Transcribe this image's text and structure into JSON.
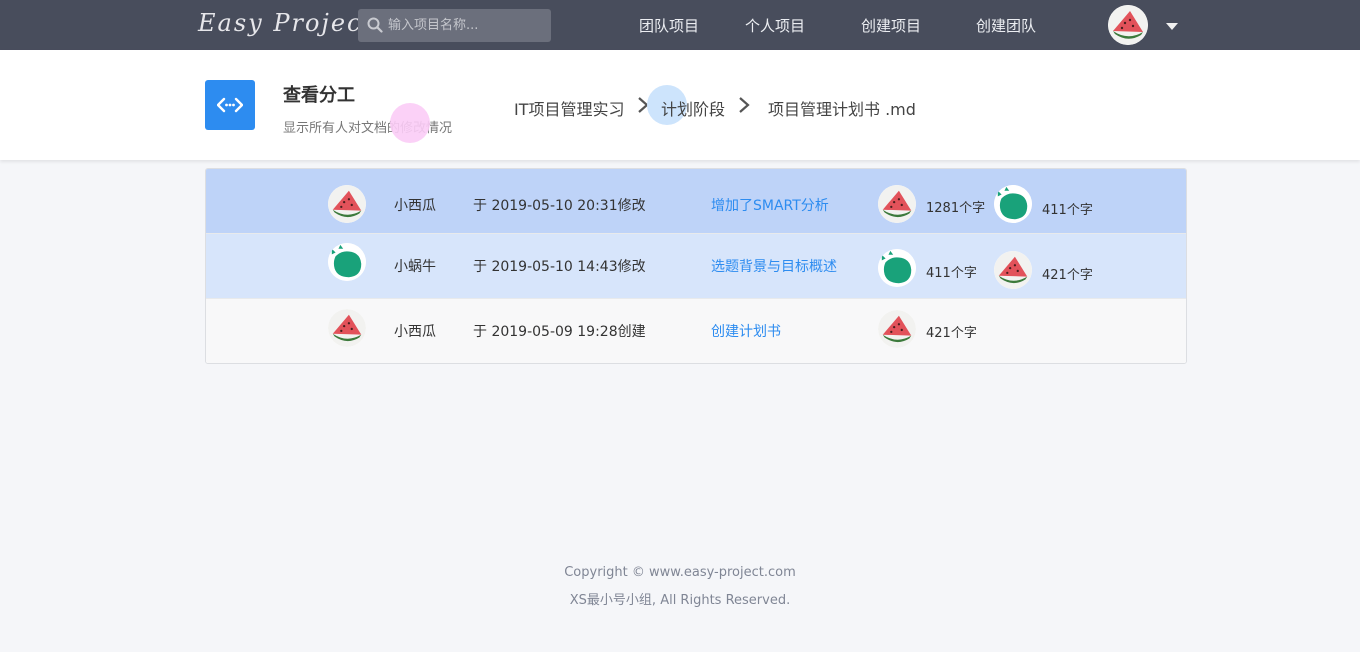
{
  "app": {
    "logo_text": "Easy Project"
  },
  "search": {
    "placeholder": "输入项目名称..."
  },
  "nav": {
    "items": [
      "团队项目",
      "个人项目",
      "创建项目",
      "创建团队"
    ]
  },
  "header": {
    "title": "查看分工",
    "subtitle": "显示所有人对文档的修改情况",
    "breadcrumb": [
      "IT项目管理实习",
      "计划阶段",
      "项目管理计划书 .md"
    ]
  },
  "edits": [
    {
      "user": "小西瓜",
      "avatar": "watermelon-avatar",
      "time": "于 2019-05-10 20:31修改",
      "message": "增加了SMART分析",
      "contributions": [
        {
          "avatar": "watermelon-avatar",
          "count": "1281个字"
        },
        {
          "avatar": "green-snail-avatar",
          "count": "411个字"
        }
      ]
    },
    {
      "user": "小蜗牛",
      "avatar": "green-snail-avatar",
      "time": "于 2019-05-10 14:43修改",
      "message": "选题背景与目标概述",
      "contributions": [
        {
          "avatar": "green-snail-avatar",
          "count": "411个字"
        },
        {
          "avatar": "watermelon-avatar",
          "count": "421个字"
        }
      ]
    },
    {
      "user": "小西瓜",
      "avatar": "watermelon-avatar",
      "time": "于 2019-05-09 19:28创建",
      "message": "创建计划书",
      "contributions": [
        {
          "avatar": "watermelon-avatar",
          "count": "421个字"
        }
      ]
    }
  ],
  "footer": {
    "copyright": "Copyright © www.easy-project.com",
    "rights": "XS最小号小组, All Rights Reserved."
  },
  "colors": {
    "topbar": "#484d5c",
    "accent": "#2d8cf0",
    "row_selected": "#bed3f8",
    "row_hover": "#d7e5fb",
    "avatar_green": "#19a27a"
  }
}
